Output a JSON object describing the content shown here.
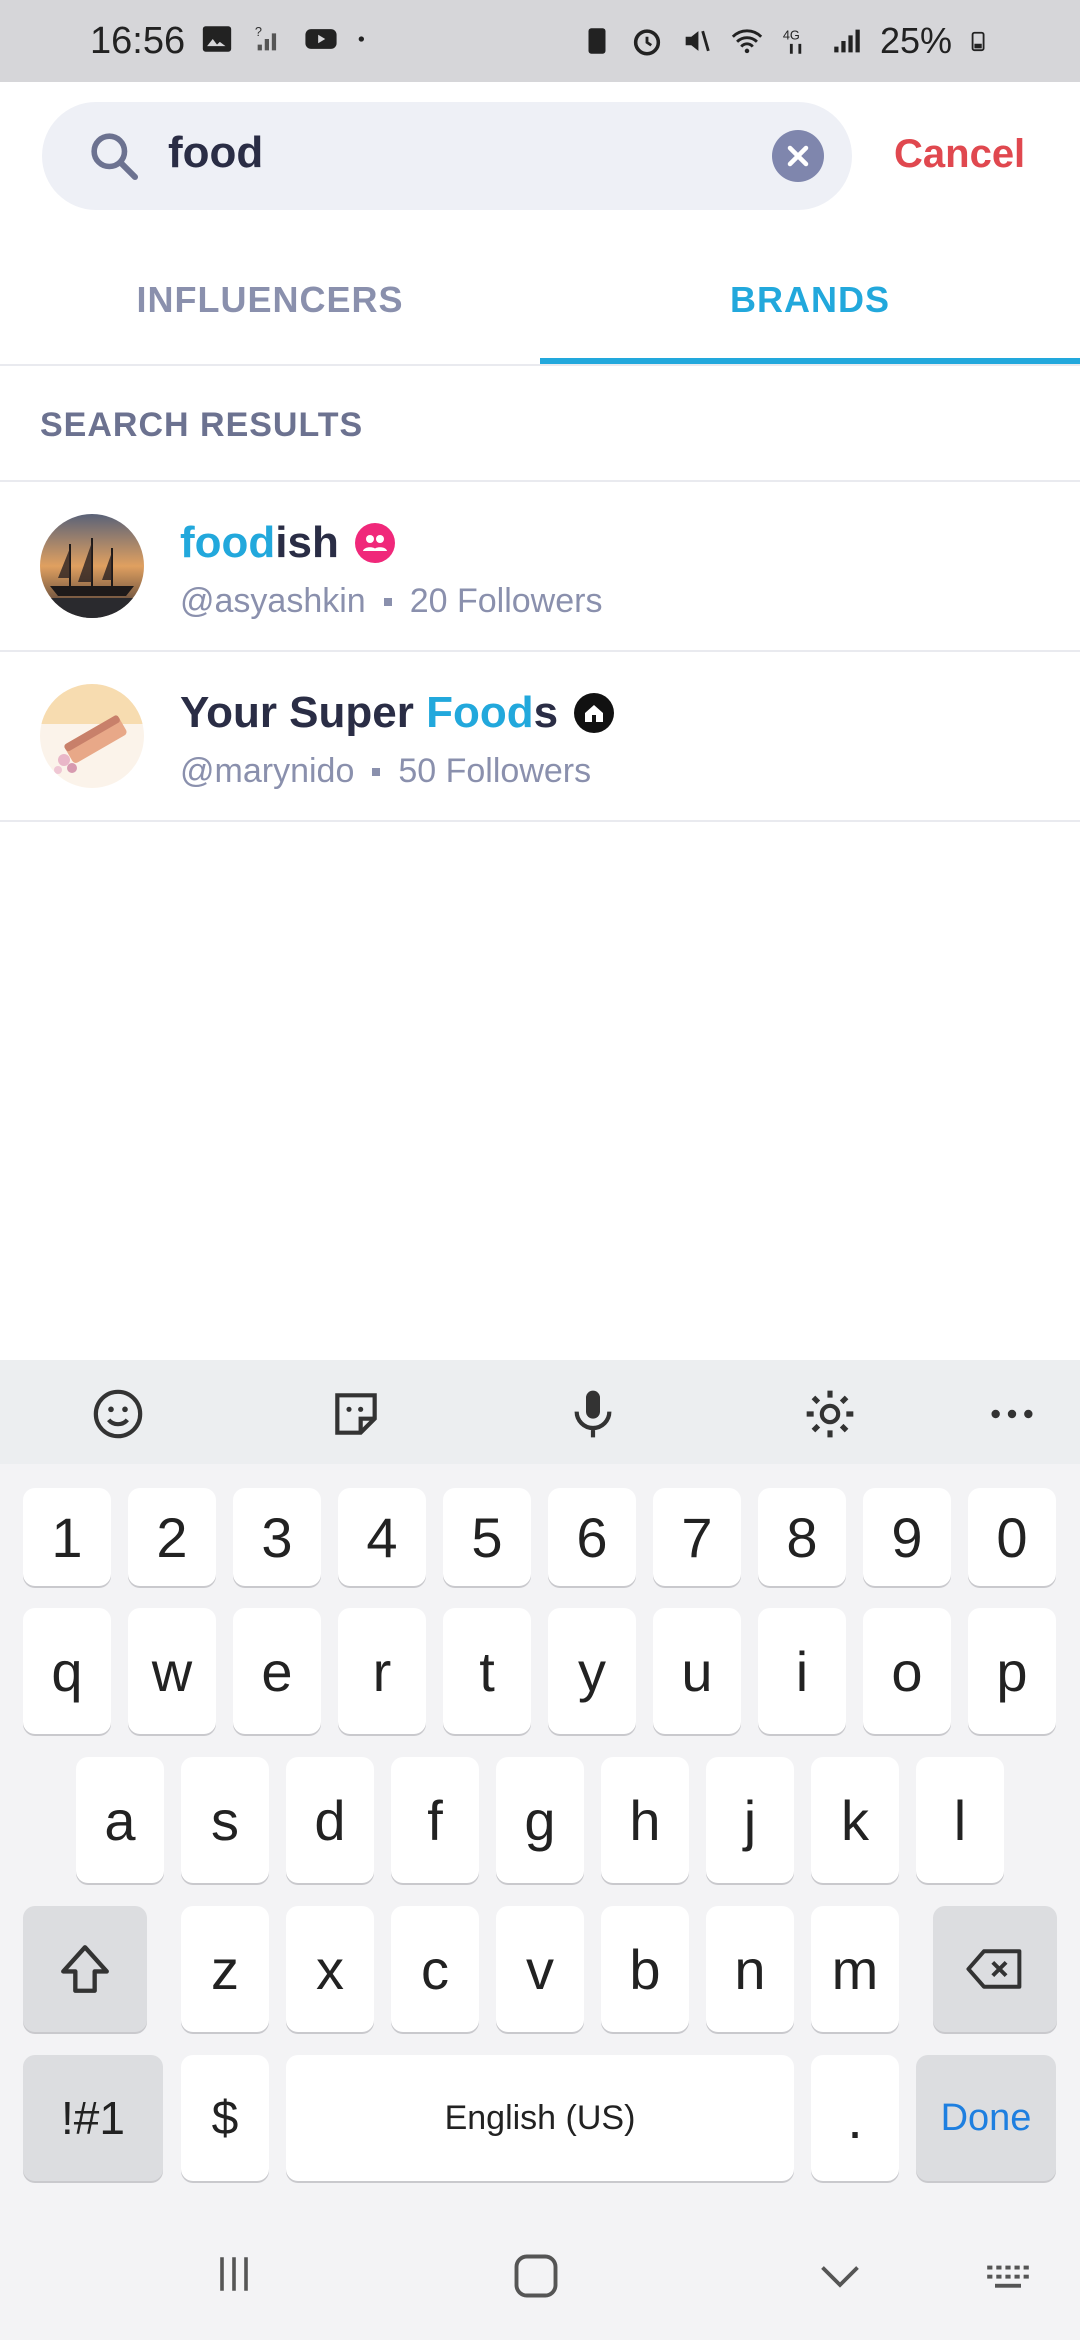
{
  "status_bar": {
    "time": "16:56",
    "battery": "25%"
  },
  "search": {
    "query": "food",
    "cancel_label": "Cancel"
  },
  "tabs": [
    {
      "label": "INFLUENCERS",
      "selected": false
    },
    {
      "label": "BRANDS",
      "selected": true
    }
  ],
  "results_section": {
    "title": "SEARCH RESULTS"
  },
  "results": [
    {
      "name_pre": "",
      "name_highlight": "food",
      "name_post": "ish",
      "handle": "@asyashkin",
      "followers": "20 Followers",
      "badge_color": "#f0287a"
    },
    {
      "name_pre": "Your Super ",
      "name_highlight": "Food",
      "name_post": "s",
      "handle": "@marynido",
      "followers": "50 Followers",
      "badge_color": "#111111"
    }
  ],
  "keyboard": {
    "row_numbers": [
      "1",
      "2",
      "3",
      "4",
      "5",
      "6",
      "7",
      "8",
      "9",
      "0"
    ],
    "row1": [
      "q",
      "w",
      "e",
      "r",
      "t",
      "y",
      "u",
      "i",
      "o",
      "p"
    ],
    "row2": [
      "a",
      "s",
      "d",
      "f",
      "g",
      "h",
      "j",
      "k",
      "l"
    ],
    "row3": [
      "z",
      "x",
      "c",
      "v",
      "b",
      "n",
      "m"
    ],
    "symbols_label": "!#1",
    "dollar_label": "$",
    "space_label": "English (US)",
    "period_label": ".",
    "done_label": "Done"
  },
  "colors": {
    "accent": "#22a8dc",
    "cancel": "#e0484f",
    "muted": "#8a90ad"
  }
}
